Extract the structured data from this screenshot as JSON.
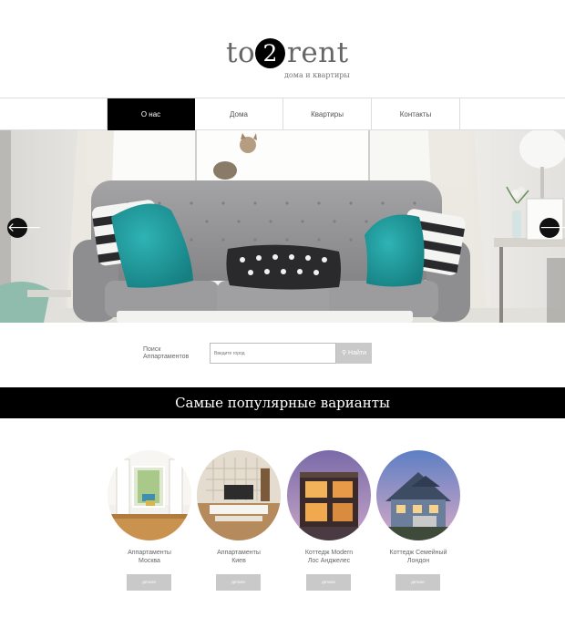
{
  "logo": {
    "part1": "to",
    "number": "2",
    "part2": "rent",
    "tagline": "дома и квартиры"
  },
  "nav": {
    "items": [
      {
        "label": "О нас",
        "active": true
      },
      {
        "label": "Дома",
        "active": false
      },
      {
        "label": "Квартиры",
        "active": false
      },
      {
        "label": "Контакты",
        "active": false
      }
    ]
  },
  "hero": {
    "prev_icon": "arrow-left-icon",
    "next_icon": "arrow-right-icon",
    "prev_glyph": "🡐",
    "next_glyph": "🡒"
  },
  "search": {
    "label": "Поиск Аппартаментов",
    "placeholder": "Введите город",
    "button_label": "Найти",
    "button_icon": "search-icon",
    "button_glyph": "⚲"
  },
  "popular": {
    "heading": "Самые популярные варианты",
    "items": [
      {
        "title_line1": "Аппартаменты",
        "title_line2": "Москва",
        "button_label": "детали"
      },
      {
        "title_line1": "Аппартаменты",
        "title_line2": "Киев",
        "button_label": "детали"
      },
      {
        "title_line1": "Коттедж Modern",
        "title_line2": "Лос Анджелес",
        "button_label": "детали"
      },
      {
        "title_line1": "Коттедж Семейный",
        "title_line2": "Лондон",
        "button_label": "детали"
      }
    ]
  },
  "colors": {
    "black": "#000000",
    "teal_pillow": "#1e9ea0",
    "sofa_grey": "#9a9a9c",
    "button_grey": "#c9c9c9"
  }
}
